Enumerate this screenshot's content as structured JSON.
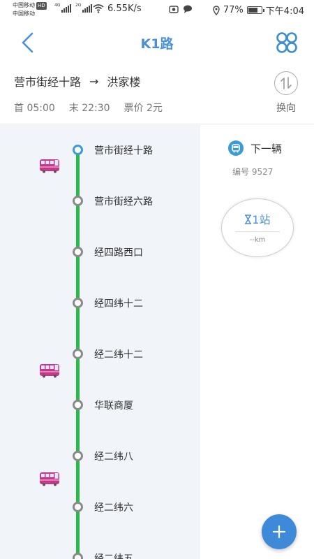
{
  "status_bar": {
    "carrier1": "中国移动",
    "carrier2": "中国移动",
    "hd": "HD",
    "net1": "4G",
    "net2": "2G",
    "speed": "6.55K/s",
    "battery_pct": "77%",
    "battery_level": 0.77,
    "time": "下午4:04"
  },
  "header": {
    "title": "K1路",
    "back_icon": "chevron-left-icon",
    "menu_icon": "four-circles-icon"
  },
  "route": {
    "from": "营市街经十路",
    "arrow": "→",
    "to": "洪家楼",
    "first_bus": "首 05:00",
    "last_bus": "末 22:30",
    "fare": "票价 2元",
    "swap_label": "换向"
  },
  "stops": [
    {
      "name": "营市街经十路",
      "current": true
    },
    {
      "name": "营市街经六路",
      "current": false
    },
    {
      "name": "经四路西口",
      "current": false
    },
    {
      "name": "经四纬十二",
      "current": false
    },
    {
      "name": "经二纬十二",
      "current": false
    },
    {
      "name": "华联商厦",
      "current": false
    },
    {
      "name": "经二纬八",
      "current": false
    },
    {
      "name": "经二纬六",
      "current": false
    },
    {
      "name": "经二纬五",
      "current": false
    }
  ],
  "next_bus": {
    "label": "下一辆",
    "number": "编号  9527",
    "eta_stops": "1站",
    "eta_km": "--km"
  },
  "colors": {
    "accent": "#4a90d9",
    "route_line": "#2db84a",
    "bus": "#c2398a"
  }
}
